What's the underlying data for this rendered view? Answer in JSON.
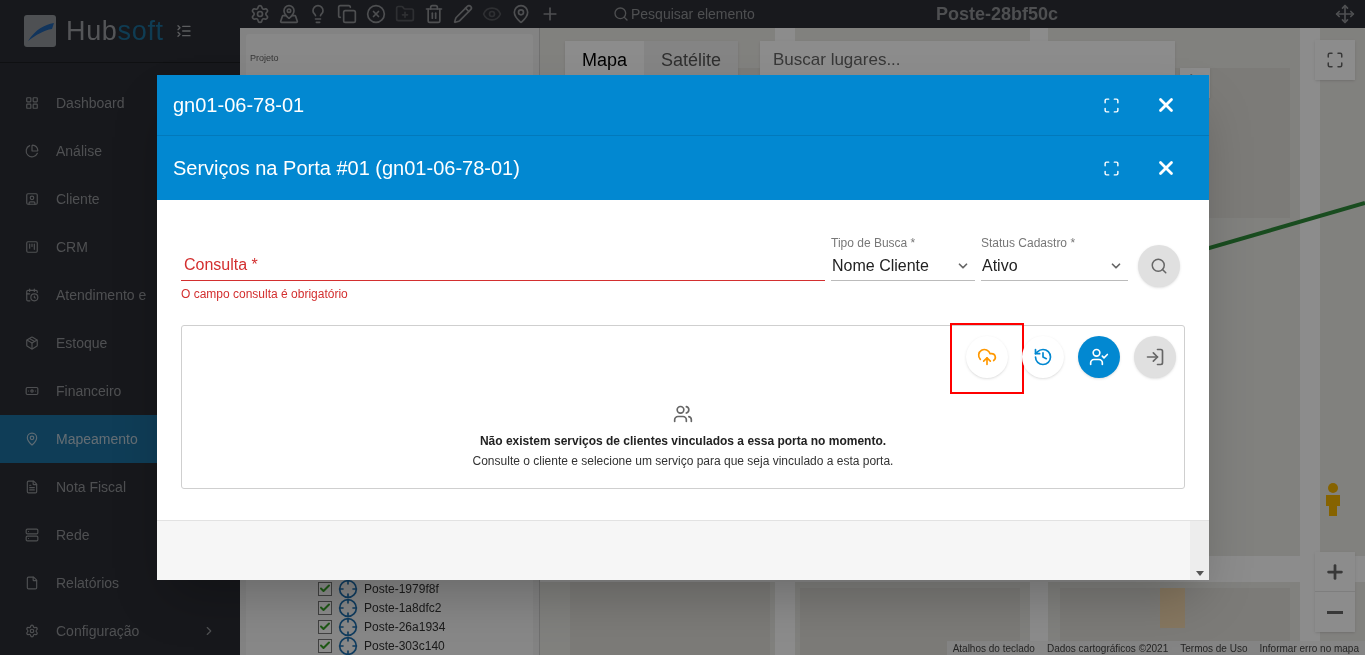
{
  "sidebar": {
    "brand": {
      "part1": "Hub",
      "part2": "soft"
    },
    "items": [
      {
        "label": "Dashboard",
        "selected": false
      },
      {
        "label": "Análise",
        "selected": false
      },
      {
        "label": "Cliente",
        "selected": false
      },
      {
        "label": "CRM",
        "selected": false
      },
      {
        "label": "Atendimento e",
        "selected": false
      },
      {
        "label": "Estoque",
        "selected": false
      },
      {
        "label": "Financeiro",
        "selected": false
      },
      {
        "label": "Mapeamento",
        "selected": true
      },
      {
        "label": "Nota Fiscal",
        "selected": false
      },
      {
        "label": "Rede",
        "selected": false
      },
      {
        "label": "Relatórios",
        "selected": false
      },
      {
        "label": "Configuração",
        "selected": false,
        "expandable": true
      }
    ]
  },
  "toolbar": {
    "tools": [
      {
        "kind": "settings",
        "disabled": false
      },
      {
        "kind": "pin",
        "disabled": false
      },
      {
        "kind": "idea",
        "disabled": false
      },
      {
        "kind": "copy",
        "disabled": false
      },
      {
        "kind": "remove",
        "disabled": false
      },
      {
        "kind": "folder",
        "disabled": true
      },
      {
        "kind": "delete",
        "disabled": false
      },
      {
        "kind": "edit",
        "disabled": false
      },
      {
        "kind": "view",
        "disabled": true
      },
      {
        "kind": "place",
        "disabled": false
      },
      {
        "kind": "add",
        "disabled": false
      }
    ],
    "search_placeholder": "Pesquisar elemento",
    "title": "Poste-28bf50c"
  },
  "project_panel": {
    "label": "Projeto",
    "items": [
      {
        "label": "Poste-1979f8f",
        "checked": true
      },
      {
        "label": "Poste-1a8dfc2",
        "checked": true
      },
      {
        "label": "Poste-26a1934",
        "checked": true
      },
      {
        "label": "Poste-303c140",
        "checked": true
      }
    ]
  },
  "map": {
    "tabs": [
      {
        "label": "Mapa",
        "selected": true
      },
      {
        "label": "Satélite",
        "selected": false
      }
    ],
    "search_placeholder": "Buscar lugares...",
    "footer_links": [
      "Atalhos do teclado",
      "Dados cartográficos ©2021",
      "Termos de Uso",
      "Informar erro no mapa"
    ]
  },
  "dialogs": [
    {
      "title": "gn01-06-78-01"
    },
    {
      "title": "Serviços na Porta #01 (gn01-06-78-01)"
    }
  ],
  "form": {
    "query": {
      "placeholder": "Consulta *",
      "error": "O campo consulta é obrigatório",
      "invalid": true
    },
    "selects": [
      {
        "label": "Tipo de Busca *",
        "value": "Nome Cliente"
      },
      {
        "label": "Status Cadastro *",
        "value": "Ativo"
      }
    ]
  },
  "actions": [
    {
      "kind": "upload",
      "highlighted": true
    },
    {
      "kind": "history",
      "highlighted": false
    },
    {
      "kind": "assign",
      "highlighted": false
    },
    {
      "kind": "enter",
      "highlighted": false
    }
  ],
  "empty_state": {
    "title": "Não existem serviços de clientes vinculados a essa porta no momento.",
    "text": "Consulte o cliente e selecione um serviço para que seja vinculado a esta porta."
  }
}
